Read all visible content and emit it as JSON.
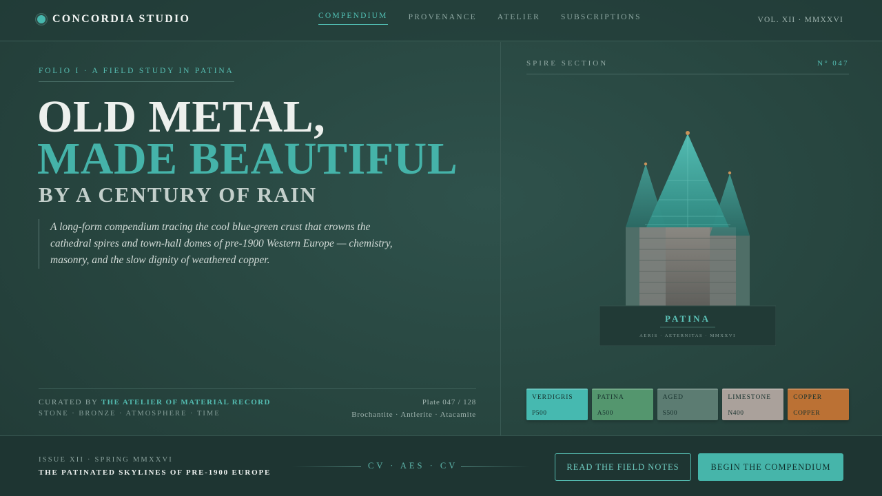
{
  "header": {
    "brand": "CONCORDIA STUDIO",
    "nav": [
      {
        "label": "COMPENDIUM",
        "active": true
      },
      {
        "label": "PROVENANCE",
        "active": false
      },
      {
        "label": "ATELIER",
        "active": false
      },
      {
        "label": "SUBSCRIPTIONS",
        "active": false
      }
    ],
    "volume": "VOL. XII · MMXXVI"
  },
  "hero": {
    "folio": "FOLIO I  ·  A FIELD STUDY IN PATINA",
    "line1": "OLD METAL,",
    "line2": "MADE BEAUTIFUL",
    "line3": "BY A CENTURY OF RAIN",
    "lede": "A long-form compendium tracing the cool blue-green crust that crowns the cathedral spires and town-hall domes of pre-1900 Western Europe — chemistry, masonry, and the slow dignity of weathered copper."
  },
  "credits": {
    "curated_prefix": "CURATED BY",
    "curator": "THE ATELIER OF MATERIAL RECORD",
    "themes": "STONE · BRONZE · ATMOSPHERE · TIME",
    "plate": "Plate 047 / 128",
    "minerals": "Brochantite · Antlerite · Atacamite"
  },
  "specimen": {
    "section_title": "SPIRE SECTION",
    "section_no": "N° 047",
    "plaque_title": "PATINA",
    "plaque_sub": "AERIS · AETERNITAS · MMXXVI"
  },
  "swatches": [
    {
      "name": "VERDIGRIS",
      "code": "P500",
      "color": "#46b9b0"
    },
    {
      "name": "PATINA",
      "code": "A500",
      "color": "#54966e"
    },
    {
      "name": "AGED",
      "code": "S500",
      "color": "#5c7c72"
    },
    {
      "name": "LIMESTONE",
      "code": "N400",
      "color": "#aaa19b"
    },
    {
      "name": "COPPER",
      "code": "COPPER",
      "color": "#bb7134"
    }
  ],
  "footer": {
    "issue": "ISSUE XII · SPRING MMXXVI",
    "issue_sub": "THE PATINATED SKYLINES OF PRE-1900 EUROPE",
    "monogram": "CV · AES · CV",
    "btn_outline": "READ THE FIELD NOTES",
    "btn_solid": "BEGIN THE COMPENDIUM"
  },
  "colors": {
    "accent": "#46b5aa",
    "background": "#27443f",
    "footer": "#1e3532"
  }
}
